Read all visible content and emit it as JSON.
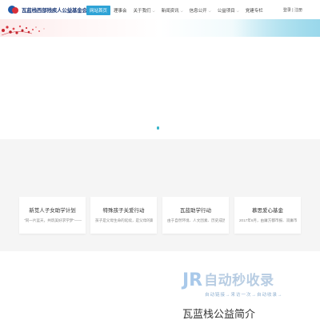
{
  "header": {
    "logo_text": "瓦蓝栈西部残疾人公益基金会",
    "nav": [
      {
        "label": "网站首页",
        "active": true,
        "caret": false
      },
      {
        "label": "理事会",
        "active": false,
        "caret": false
      },
      {
        "label": "关于我们",
        "active": false,
        "caret": true
      },
      {
        "label": "新闻资讯",
        "active": false,
        "caret": true
      },
      {
        "label": "信息公开",
        "active": false,
        "caret": true
      },
      {
        "label": "公益项目",
        "active": false,
        "caret": true
      },
      {
        "label": "党建专栏",
        "active": false,
        "caret": false
      }
    ],
    "login": "登录",
    "separator": "|",
    "register": "注册"
  },
  "cards": [
    {
      "title": "新苋人子女助学计划",
      "desc": "\"同一片蓝天，共筑美好求学梦\"——..."
    },
    {
      "title": "特殊孩子关爱行动",
      "desc": "孩子是父母生命的延续，是父母的期..."
    },
    {
      "title": "瓦蓝助学行动",
      "desc": "由于自然环境、人文因素、历史成因..."
    },
    {
      "title": "慕思爱心基金",
      "desc": "2017年6月，由庸方都市报、双庸市..."
    }
  ],
  "watermark": {
    "icon": "JR",
    "main": "自动秒收录",
    "sub": "自动链接→来访一次→自动收录→"
  },
  "intro": {
    "title": "瓦蓝栈公益简介"
  },
  "colors": {
    "accent": "#2ea3d6",
    "slider_dot": "#35b4c9",
    "grey_bg": "#f5f5f5"
  }
}
